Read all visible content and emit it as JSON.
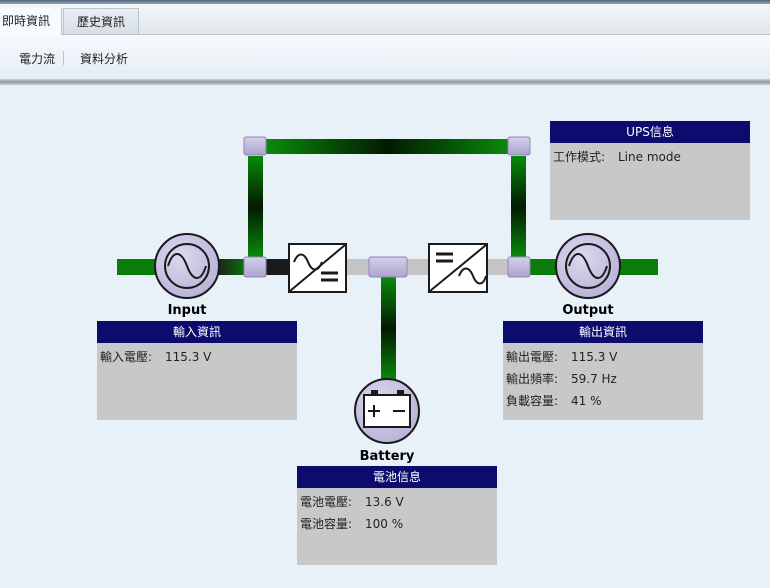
{
  "tabs": [
    {
      "label": "即時資訊",
      "active": true
    },
    {
      "label": "歷史資訊",
      "active": false
    }
  ],
  "subnav": [
    {
      "label": "電力流"
    },
    {
      "label": "資料分析"
    }
  ],
  "diagram": {
    "labels": {
      "input": "Input",
      "output": "Output",
      "battery": "Battery"
    },
    "colors": {
      "power_line": "#0a7d0a",
      "idle_line": "#c4c4c4",
      "node": "#c8c4e0",
      "panel_head": "#0b0c6e"
    }
  },
  "ups_panel": {
    "title": "UPS信息",
    "rows": [
      {
        "label": "工作模式:",
        "value": "Line mode"
      }
    ]
  },
  "input_panel": {
    "title": "輸入資訊",
    "rows": [
      {
        "label": "輸入電壓:",
        "value": "115.3 V"
      }
    ]
  },
  "output_panel": {
    "title": "輸出資訊",
    "rows": [
      {
        "label": "輸出電壓:",
        "value": "115.3 V"
      },
      {
        "label": "輸出頻率:",
        "value": "59.7 Hz"
      },
      {
        "label": "負載容量:",
        "value": "41 %"
      }
    ]
  },
  "battery_panel": {
    "title": "電池信息",
    "rows": [
      {
        "label": "電池電壓:",
        "value": "13.6 V"
      },
      {
        "label": "電池容量:",
        "value": "100 %"
      }
    ]
  }
}
